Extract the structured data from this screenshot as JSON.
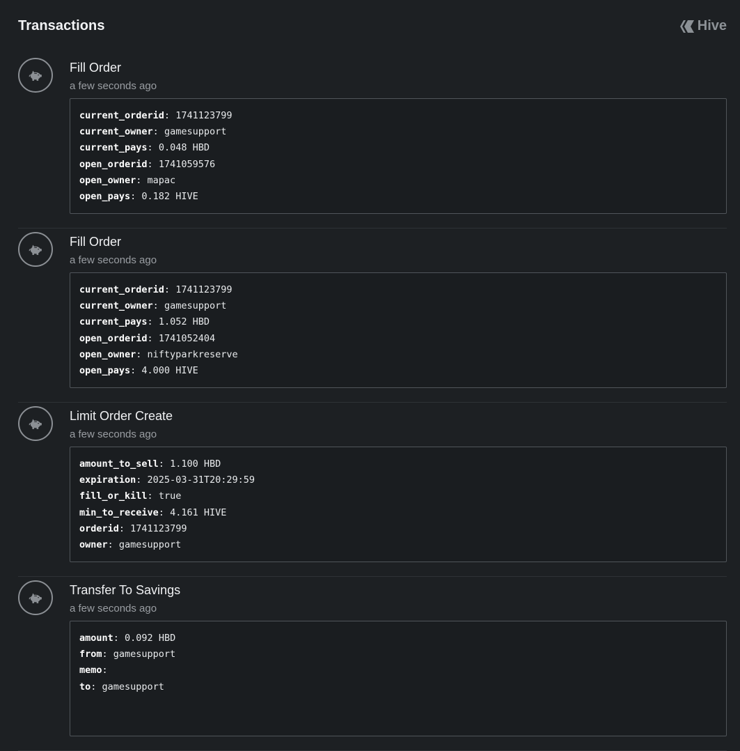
{
  "header": {
    "title": "Transactions",
    "brand": "Hive"
  },
  "transactions": [
    {
      "title": "Fill Order",
      "time": "a few seconds ago",
      "fields": [
        {
          "key": "current_orderid",
          "value": "1741123799"
        },
        {
          "key": "current_owner",
          "value": "gamesupport"
        },
        {
          "key": "current_pays",
          "value": "0.048 HBD"
        },
        {
          "key": "open_orderid",
          "value": "1741059576"
        },
        {
          "key": "open_owner",
          "value": "mapac"
        },
        {
          "key": "open_pays",
          "value": "0.182 HIVE"
        }
      ]
    },
    {
      "title": "Fill Order",
      "time": "a few seconds ago",
      "fields": [
        {
          "key": "current_orderid",
          "value": "1741123799"
        },
        {
          "key": "current_owner",
          "value": "gamesupport"
        },
        {
          "key": "current_pays",
          "value": "1.052 HBD"
        },
        {
          "key": "open_orderid",
          "value": "1741052404"
        },
        {
          "key": "open_owner",
          "value": "niftyparkreserve"
        },
        {
          "key": "open_pays",
          "value": "4.000 HIVE"
        }
      ]
    },
    {
      "title": "Limit Order Create",
      "time": "a few seconds ago",
      "fields": [
        {
          "key": "amount_to_sell",
          "value": "1.100 HBD"
        },
        {
          "key": "expiration",
          "value": "2025-03-31T20:29:59"
        },
        {
          "key": "fill_or_kill",
          "value": "true"
        },
        {
          "key": "min_to_receive",
          "value": "4.161 HIVE"
        },
        {
          "key": "orderid",
          "value": "1741123799"
        },
        {
          "key": "owner",
          "value": "gamesupport"
        }
      ]
    },
    {
      "title": "Transfer To Savings",
      "time": "a few seconds ago",
      "fields": [
        {
          "key": "amount",
          "value": "0.092 HBD"
        },
        {
          "key": "from",
          "value": "gamesupport"
        },
        {
          "key": "memo",
          "value": ""
        },
        {
          "key": "to",
          "value": "gamesupport"
        }
      ]
    }
  ],
  "icons": {
    "transaction": "piggy-bank-icon",
    "brand": "hive-logo-icon"
  },
  "colors": {
    "background": "#1d2023",
    "code_background": "#1a1d20",
    "border": "#50555a",
    "muted": "#9a9ea3"
  }
}
